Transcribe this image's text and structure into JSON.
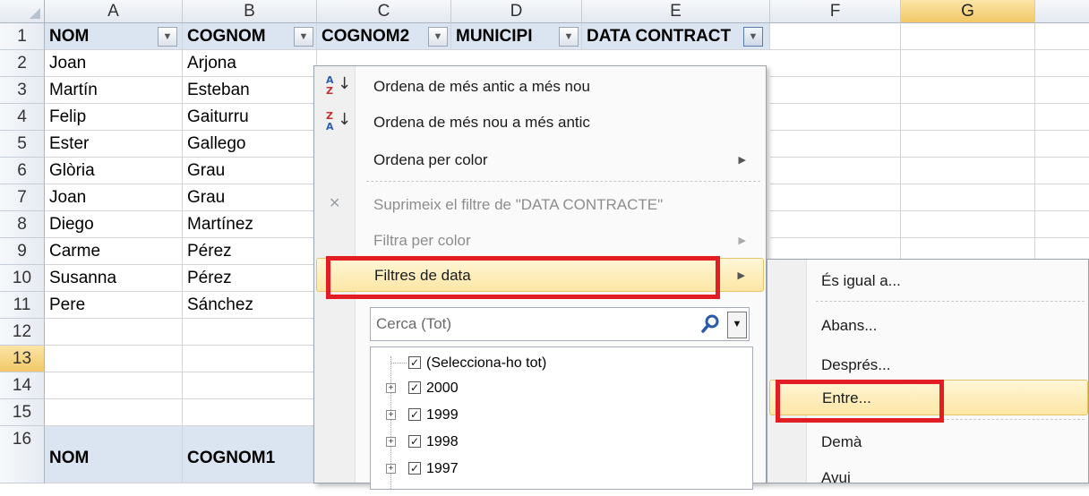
{
  "columns": [
    "A",
    "B",
    "C",
    "D",
    "E",
    "F",
    "G"
  ],
  "selected_column": "G",
  "selected_row": 13,
  "row_numbers": [
    "1",
    "2",
    "3",
    "4",
    "5",
    "6",
    "7",
    "8",
    "9",
    "10",
    "11",
    "12",
    "13",
    "14",
    "15",
    "16"
  ],
  "header_row": [
    "NOM",
    "COGNOM",
    "COGNOM2",
    "MUNICIPI",
    "DATA CONTRACT"
  ],
  "rows": [
    [
      "Joan",
      "Arjona"
    ],
    [
      "Martín",
      "Esteban"
    ],
    [
      "Felip",
      "Gaiturru"
    ],
    [
      "Ester",
      "Gallego"
    ],
    [
      "Glòria",
      "Grau"
    ],
    [
      "Joan",
      "Grau"
    ],
    [
      "Diego",
      "Martínez"
    ],
    [
      "Carme",
      "Pérez"
    ],
    [
      "Susanna",
      "Pérez"
    ],
    [
      "Pere",
      "Sánchez"
    ]
  ],
  "row16": [
    "NOM",
    "COGNOM1"
  ],
  "filter_menu": {
    "sort_asc": "Ordena de més antic a més nou",
    "sort_desc": "Ordena de més nou a més antic",
    "sort_color": "Ordena per color",
    "clear_filter": "Suprimeix el filtre de \"DATA CONTRACTE\"",
    "filter_color": "Filtra per color",
    "date_filters": "Filtres de data",
    "search_placeholder": "Cerca (Tot)",
    "tree": [
      "(Selecciona-ho tot)",
      "2000",
      "1999",
      "1998",
      "1997"
    ]
  },
  "date_submenu": [
    "És igual a...",
    "Abans...",
    "Després...",
    "Entre...",
    "Demà",
    "Avui"
  ],
  "icons": {
    "sort_asc": "sort-a-z-icon",
    "sort_desc": "sort-z-a-icon",
    "clear": "clear-filter-icon",
    "search": "magnifier-icon"
  },
  "colors": {
    "highlight_box": "#e21d24",
    "menu_highlight": "#fde7a6",
    "header_fill": "#dbe5f1"
  }
}
